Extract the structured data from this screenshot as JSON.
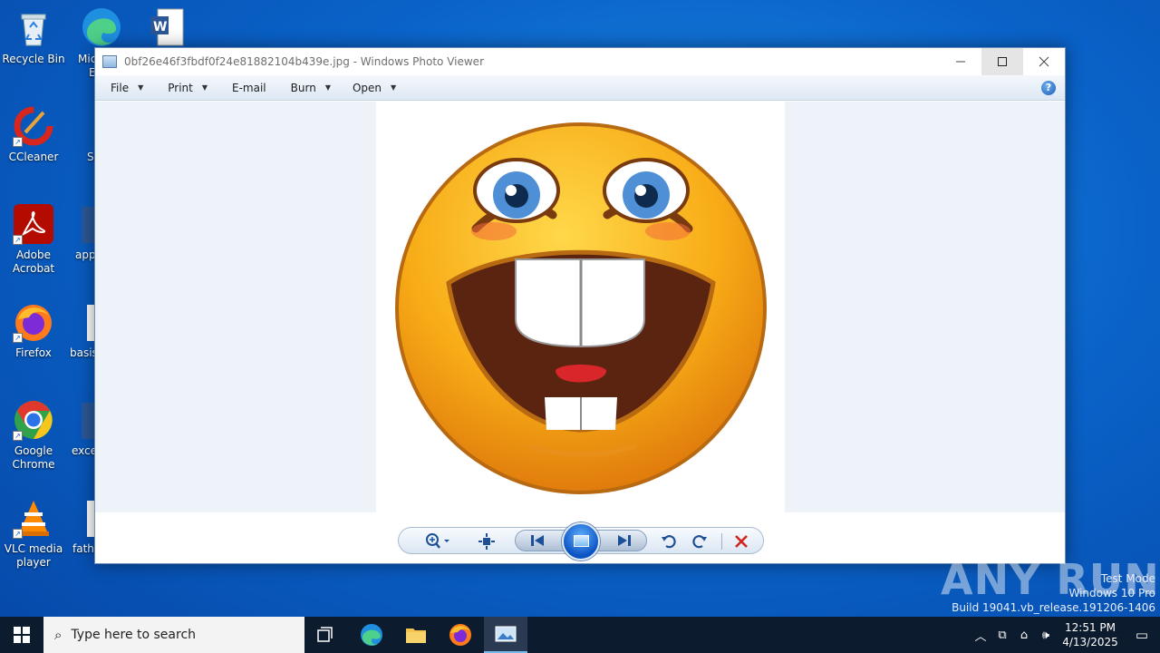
{
  "desktop": {
    "icons": [
      {
        "label": "Recycle Bin"
      },
      {
        "label": "CCleaner"
      },
      {
        "label": "Adobe Acrobat"
      },
      {
        "label": "Firefox"
      },
      {
        "label": "Google Chrome"
      },
      {
        "label": "VLC media player"
      }
    ],
    "partial_labels": [
      "Mic",
      "E",
      "Sk",
      "app",
      "basis",
      "exce",
      "fath"
    ]
  },
  "window": {
    "title": "0bf26e46f3fbdf0f24e81882104b439e.jpg - Windows Photo Viewer",
    "menu": [
      {
        "label": "File",
        "has_arrow": true
      },
      {
        "label": "Print",
        "has_arrow": true
      },
      {
        "label": "E-mail",
        "has_arrow": false
      },
      {
        "label": "Burn",
        "has_arrow": true
      },
      {
        "label": "Open",
        "has_arrow": true
      }
    ],
    "help_symbol": "?"
  },
  "taskbar": {
    "search_placeholder": "Type here to search",
    "time": "12:51 PM",
    "date": "4/13/2025"
  },
  "watermark": {
    "brand": "ANY RUN",
    "line1": "Test Mode",
    "line2": "Windows 10 Pro",
    "line3": "Build 19041.vb_release.191206-1406"
  }
}
